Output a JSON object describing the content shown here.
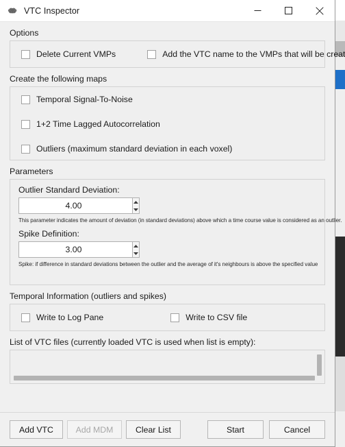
{
  "window": {
    "title": "VTC Inspector",
    "icon": "brain-icon",
    "controls": {
      "minimize": "minimize-icon",
      "maximize": "maximize-icon",
      "close": "close-icon"
    }
  },
  "options": {
    "group_label": "Options",
    "checkboxes": [
      {
        "label": "Delete Current VMPs",
        "checked": false
      },
      {
        "label": "Add the VTC name to the VMPs that will be created",
        "checked": false
      }
    ]
  },
  "maps": {
    "group_label": "Create the following maps",
    "checkboxes": [
      {
        "label": "Temporal Signal-To-Noise",
        "checked": false
      },
      {
        "label": "1+2 Time Lagged Autocorrelation",
        "checked": false
      },
      {
        "label": "Outliers (maximum standard deviation in each voxel)",
        "checked": false
      }
    ]
  },
  "parameters": {
    "group_label": "Parameters",
    "outlier": {
      "label": "Outlier Standard Deviation:",
      "value": "4.00",
      "hint": "This parameter indicates the amount of deviation (in standard deviations) above which a time course value is considered as an outlier."
    },
    "spike": {
      "label": "Spike Definition:",
      "value": "3.00",
      "hint": "Spike: if difference in standard deviations between the outlier and the average of it's neighbours is above the specified value"
    }
  },
  "temporal": {
    "group_label": "Temporal Information (outliers and spikes)",
    "checkboxes": [
      {
        "label": "Write to Log Pane",
        "checked": false
      },
      {
        "label": "Write to CSV file",
        "checked": false
      }
    ]
  },
  "vtc_list": {
    "label": "List of VTC files (currently loaded VTC is used when list is empty):",
    "items": []
  },
  "footer": {
    "add_vtc": "Add VTC",
    "add_mdm": "Add MDM",
    "add_mdm_disabled": true,
    "clear_list": "Clear List",
    "start": "Start",
    "cancel": "Cancel"
  },
  "colors": {
    "window_bg": "#f0f0f0",
    "group_bg": "#efefef",
    "group_border": "#d2d2d2",
    "text": "#1a1a1a",
    "disabled_text": "#a8a8a8",
    "scrollbar": "#b3b3b3",
    "titlebar_bg": "#ffffff"
  }
}
